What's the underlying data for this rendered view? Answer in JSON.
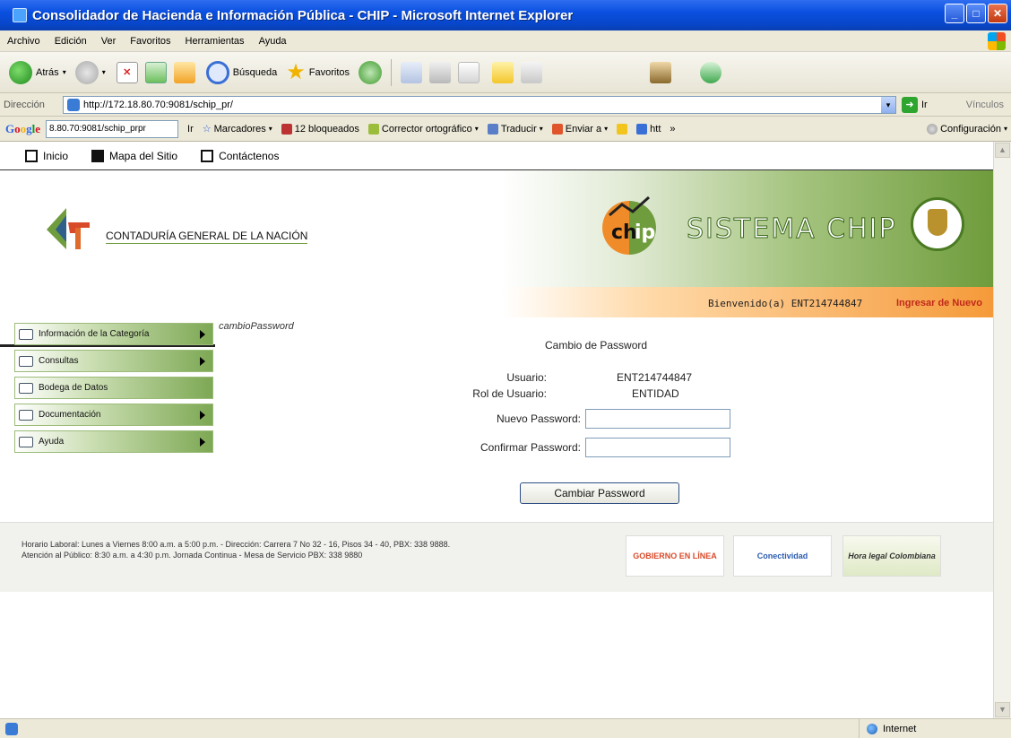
{
  "window": {
    "title": "Consolidador de Hacienda e Información Pública - CHIP - Microsoft Internet Explorer"
  },
  "menu": [
    "Archivo",
    "Edición",
    "Ver",
    "Favoritos",
    "Herramientas",
    "Ayuda"
  ],
  "toolbar": {
    "back": "Atrás",
    "search": "Búsqueda",
    "favorites": "Favoritos"
  },
  "address": {
    "label": "Dirección",
    "url": "http://172.18.80.70:9081/schip_pr/",
    "go": "Ir",
    "links": "Vínculos"
  },
  "google": {
    "logo": [
      "G",
      "o",
      "o",
      "g",
      "l",
      "e"
    ],
    "search_value": "8.80.70:9081/schip_prpr",
    "go": "Ir",
    "bookmarks": "Marcadores",
    "blocked": "12 bloqueados",
    "spell": "Corrector ortográfico",
    "translate": "Traducir",
    "send": "Enviar a",
    "htt": "htt",
    "more": "»",
    "settings": "Configuración"
  },
  "site": {
    "topnav": [
      "Inicio",
      "Mapa del Sitio",
      "Contáctenos"
    ],
    "org_name": "CONTADURÍA GENERAL DE LA NACIÓN",
    "system_name": "SISTEMA CHIP",
    "welcome": "Bienvenido(a) ENT214744847",
    "reenter": "Ingresar de Nuevo",
    "sidebar": [
      {
        "label": "Información de la Categoría",
        "arrow": true
      },
      {
        "label": "Consultas",
        "arrow": true
      },
      {
        "label": "Bodega de Datos",
        "arrow": false
      },
      {
        "label": "Documentación",
        "arrow": true
      },
      {
        "label": "Ayuda",
        "arrow": true
      }
    ]
  },
  "form": {
    "crumb": "cambioPassword",
    "title": "Cambio de Password",
    "user_label": "Usuario:",
    "user_value": "ENT214744847",
    "role_label": "Rol de Usuario:",
    "role_value": "ENTIDAD",
    "new_label": "Nuevo Password:",
    "new_value": "",
    "confirm_label": "Confirmar Password:",
    "confirm_value": "",
    "submit": "Cambiar Password"
  },
  "footer": {
    "line1": "Horario Laboral: Lunes a Viernes 8:00 a.m. a 5:00 p.m. - Dirección: Carrera 7 No 32 - 16, Pisos 34 - 40, PBX: 338 9888.",
    "line2": "Atención al Público: 8:30 a.m. a 4:30 p.m. Jornada Continua - Mesa de Servicio PBX: 338 9880",
    "logo_gobierno": "GOBIERNO EN LÍNEA",
    "logo_conectividad": "Conectividad",
    "logo_hora": "Hora legal Colombiana"
  },
  "status": {
    "zone": "Internet"
  }
}
